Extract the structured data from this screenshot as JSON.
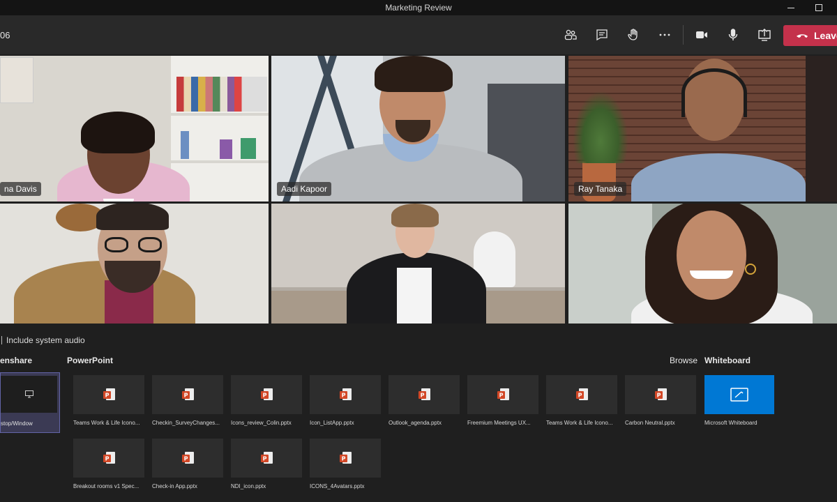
{
  "window": {
    "title": "Marketing Review"
  },
  "toolbar": {
    "timer": "06",
    "buttons": [
      {
        "icon": "people-icon"
      },
      {
        "icon": "chat-icon"
      },
      {
        "icon": "raise-hand-icon"
      },
      {
        "icon": "more-icon"
      },
      {
        "icon": "camera-icon"
      },
      {
        "icon": "microphone-icon"
      },
      {
        "icon": "share-screen-icon"
      }
    ],
    "leave_label": "Leave",
    "leave_color": "#c4314b"
  },
  "participants": [
    {
      "name": "na Davis"
    },
    {
      "name": "Aadi Kapoor"
    },
    {
      "name": "Ray Tanaka"
    },
    {
      "name": ""
    },
    {
      "name": ""
    },
    {
      "name": ""
    }
  ],
  "share_tray": {
    "system_audio_label": "Include system audio",
    "sections": {
      "screenshare": "enshare",
      "powerpoint": "PowerPoint",
      "browse": "Browse",
      "whiteboard": "Whiteboard"
    },
    "desktop_caption": "stop/Window",
    "files_row1": [
      "Teams Work & Life Icono...",
      "Checkin_SurveyChanges...",
      "Icons_review_Colin.pptx",
      "Icon_ListApp.pptx",
      "Outlook_agenda.pptx",
      "Freemium Meetings  UX...",
      "Teams Work & Life Icono...",
      "Carbon Neutral.pptx"
    ],
    "files_row2": [
      "Breakout rooms v1 Spec...",
      "Check-in App.pptx",
      "NDI_icon.pptx",
      "ICONS_4Avatars.pptx"
    ],
    "whiteboard_caption": "Microsoft Whiteboard",
    "accent_color": "#6264a7",
    "whiteboard_color": "#0078d4",
    "ppt_color": "#d24726"
  }
}
